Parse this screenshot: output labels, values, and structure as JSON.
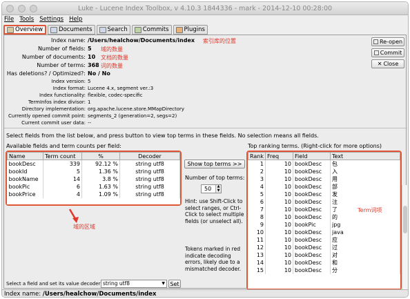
{
  "window": {
    "title": "Luke - Lucene Index Toolbox, v 4.10.3 1844336 - mark - 2014-12-10 00:28:00"
  },
  "menu": [
    "File",
    "Tools",
    "Settings",
    "Help"
  ],
  "tabs": [
    {
      "label": "Overview",
      "icon": "home-icon"
    },
    {
      "label": "Documents",
      "icon": "document-icon"
    },
    {
      "label": "Search",
      "icon": "search-icon"
    },
    {
      "label": "Commits",
      "icon": "commits-icon"
    },
    {
      "label": "Plugins",
      "icon": "plugins-icon"
    }
  ],
  "info": {
    "index_name_label": "Index name:",
    "index_name": "/Users/healchow/Documents/index",
    "fields_label": "Number of fields:",
    "fields": "5",
    "documents_label": "Number of documents:",
    "documents": "10",
    "terms_label": "Number of terms:",
    "terms": "368",
    "deletions_label": "Has deletions? / Optimized?:",
    "deletions": "No / No",
    "version_label": "Index version:",
    "version": "5",
    "format_label": "Index format:",
    "format": "Lucene 4.x, segment ver.:3",
    "functionality_label": "Index functionality:",
    "functionality": "flexible, codec-specific",
    "divisor_label": "TermInfos index divisor:",
    "divisor": "1",
    "directory_label": "Directory implementation:",
    "directory": "org.apache.lucene.store.MMapDirectory",
    "commit_label": "Currently opened commit point:",
    "commit": "segments_2 (generation=2, segs=2)",
    "userdata_label": "Current commit user data:",
    "userdata": "--"
  },
  "annotations": {
    "index_location": "索引库的位置",
    "field_count": "域的数量",
    "doc_count": "文档的数量",
    "term_count": "词的数量",
    "field_area": "域的区域",
    "term_items": "Term词项"
  },
  "buttons": {
    "reopen": "Re-open",
    "commit": "Commit",
    "close": "Close"
  },
  "select_text": "Select fields from the list below, and press button to view top terms in these fields. No selection means all fields.",
  "fields_panel": {
    "title": "Available fields and term counts per field:",
    "headers": [
      "Name",
      "Term count",
      "%",
      "Decoder"
    ],
    "rows": [
      [
        "bookDesc",
        "339",
        "92.12 %",
        "string utf8"
      ],
      [
        "bookId",
        "5",
        "1.36 %",
        "string utf8"
      ],
      [
        "bookName",
        "14",
        "3.8 %",
        "string utf8"
      ],
      [
        "bookPic",
        "6",
        "1.63 %",
        "string utf8"
      ],
      [
        "bookPrice",
        "4",
        "1.09 %",
        "string utf8"
      ]
    ]
  },
  "middle": {
    "show_button": "Show top terms >>",
    "num_label": "Number of top terms:",
    "num_value": "50",
    "hint": "Hint: use Shift-Click to select ranges, or Ctrl-Click to select multiple fields (or unselect all).",
    "tokens_note": "Tokens marked in red indicate decoding errors, likely due to a mismatched decoder."
  },
  "terms_panel": {
    "title": "Top ranking terms. (Right-click for more options)",
    "headers": [
      "Rank",
      "Freq",
      "Field",
      "Text"
    ],
    "rows": [
      [
        "1",
        "10",
        "bookDesc",
        "包"
      ],
      [
        "2",
        "10",
        "bookDesc",
        "入"
      ],
      [
        "3",
        "10",
        "bookDesc",
        "用"
      ],
      [
        "4",
        "10",
        "bookDesc",
        "部"
      ],
      [
        "5",
        "10",
        "bookDesc",
        "发"
      ],
      [
        "6",
        "10",
        "bookDesc",
        "注"
      ],
      [
        "7",
        "10",
        "bookDesc",
        "了"
      ],
      [
        "8",
        "10",
        "bookDesc",
        "的"
      ],
      [
        "9",
        "10",
        "bookPic",
        "jpg"
      ],
      [
        "10",
        "10",
        "bookDesc",
        "java"
      ],
      [
        "11",
        "10",
        "bookDesc",
        "应"
      ],
      [
        "12",
        "10",
        "bookDesc",
        "过"
      ],
      [
        "13",
        "10",
        "bookDesc",
        "对"
      ],
      [
        "14",
        "10",
        "bookDesc",
        "和"
      ],
      [
        "15",
        "10",
        "bookDesc",
        "分"
      ]
    ]
  },
  "decoder": {
    "label": "Select a field and set its value decoder:",
    "value": "string utf8",
    "set_button": "Set"
  },
  "status": {
    "label": "Index name:",
    "value": "/Users/healchow/Documents/index"
  },
  "colors": {
    "annotation": "#e0392b",
    "highlight_border": "#e05533"
  }
}
